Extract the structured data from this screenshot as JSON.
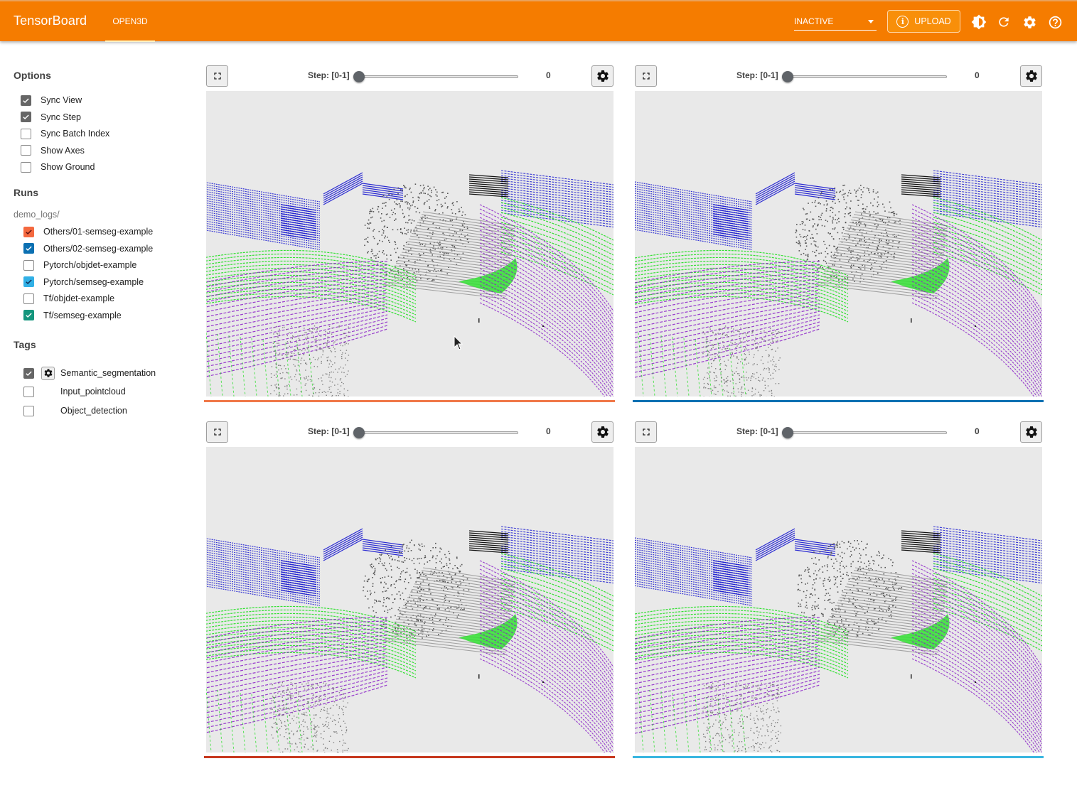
{
  "header": {
    "brand": "TensorBoard",
    "active_tab": "OPEN3D",
    "run_state_select": "INACTIVE",
    "upload_label": "UPLOAD",
    "icons": [
      "info-icon",
      "brightness-icon",
      "refresh-icon",
      "settings-icon",
      "help-icon"
    ]
  },
  "sidebar": {
    "options_title": "Options",
    "options": [
      {
        "label": "Sync View",
        "checked": true
      },
      {
        "label": "Sync Step",
        "checked": true
      },
      {
        "label": "Sync Batch Index",
        "checked": false
      },
      {
        "label": "Show Axes",
        "checked": false
      },
      {
        "label": "Show Ground",
        "checked": false
      }
    ],
    "runs_title": "Runs",
    "runs_group": "demo_logs/",
    "runs": [
      {
        "label": "Others/01-semseg-example",
        "checked": true,
        "color": "#f4693f"
      },
      {
        "label": "Others/02-semseg-example",
        "checked": true,
        "color": "#0b70b2"
      },
      {
        "label": "Pytorch/objdet-example",
        "checked": false,
        "color": "#8a8a8a"
      },
      {
        "label": "Pytorch/semseg-example",
        "checked": true,
        "color": "#31b0e6"
      },
      {
        "label": "Tf/objdet-example",
        "checked": false,
        "color": "#8a8a8a"
      },
      {
        "label": "Tf/semseg-example",
        "checked": true,
        "color": "#14967d"
      }
    ],
    "tags_title": "Tags",
    "tags": [
      {
        "label": "Semantic_segmentation",
        "checked": true,
        "has_settings": true
      },
      {
        "label": "Input_pointcloud",
        "checked": false,
        "has_settings": false
      },
      {
        "label": "Object_detection",
        "checked": false,
        "has_settings": false
      }
    ]
  },
  "panels": [
    {
      "step_label": "Step: [0-1]",
      "step_value": "0",
      "step_fraction": 0,
      "run_color": "#f07848"
    },
    {
      "step_label": "Step: [0-1]",
      "step_value": "0",
      "step_fraction": 0,
      "run_color": "#0b70b2"
    },
    {
      "step_label": "Step: [0-1]",
      "step_value": "0",
      "step_fraction": 0,
      "run_color": "#c7381e"
    },
    {
      "step_label": "Step: [0-1]",
      "step_value": "0",
      "step_fraction": 0,
      "run_color": "#38b6e0"
    }
  ],
  "colors": {
    "header_bg": "#f57c00",
    "checkbox_gray": "#616161",
    "pointcloud_blue": "#1818d0",
    "pointcloud_green": "#33e033",
    "pointcloud_purple": "#8a1fc8",
    "pointcloud_gray": "#6a6a6a"
  }
}
